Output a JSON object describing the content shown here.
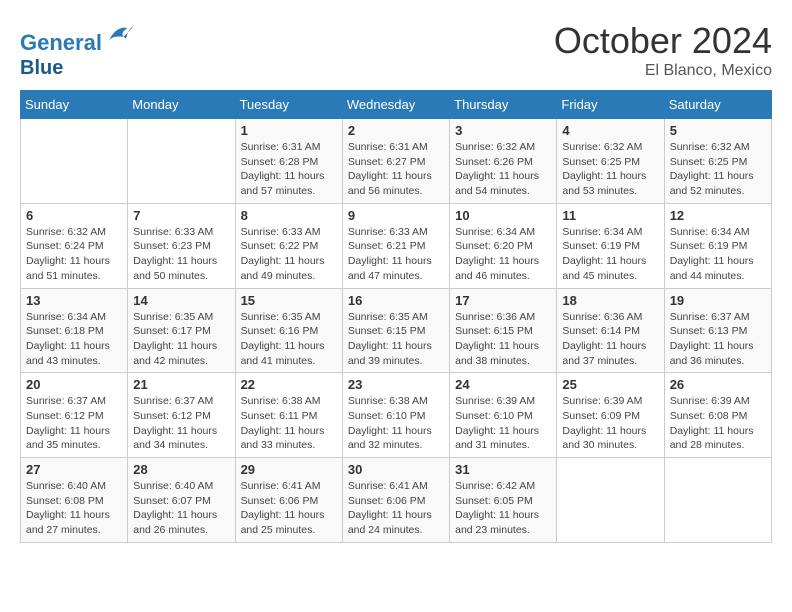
{
  "header": {
    "logo_line1": "General",
    "logo_line2": "Blue",
    "month": "October 2024",
    "location": "El Blanco, Mexico"
  },
  "weekdays": [
    "Sunday",
    "Monday",
    "Tuesday",
    "Wednesday",
    "Thursday",
    "Friday",
    "Saturday"
  ],
  "weeks": [
    [
      {
        "day": "",
        "info": ""
      },
      {
        "day": "",
        "info": ""
      },
      {
        "day": "1",
        "info": "Sunrise: 6:31 AM\nSunset: 6:28 PM\nDaylight: 11 hours and 57 minutes."
      },
      {
        "day": "2",
        "info": "Sunrise: 6:31 AM\nSunset: 6:27 PM\nDaylight: 11 hours and 56 minutes."
      },
      {
        "day": "3",
        "info": "Sunrise: 6:32 AM\nSunset: 6:26 PM\nDaylight: 11 hours and 54 minutes."
      },
      {
        "day": "4",
        "info": "Sunrise: 6:32 AM\nSunset: 6:25 PM\nDaylight: 11 hours and 53 minutes."
      },
      {
        "day": "5",
        "info": "Sunrise: 6:32 AM\nSunset: 6:25 PM\nDaylight: 11 hours and 52 minutes."
      }
    ],
    [
      {
        "day": "6",
        "info": "Sunrise: 6:32 AM\nSunset: 6:24 PM\nDaylight: 11 hours and 51 minutes."
      },
      {
        "day": "7",
        "info": "Sunrise: 6:33 AM\nSunset: 6:23 PM\nDaylight: 11 hours and 50 minutes."
      },
      {
        "day": "8",
        "info": "Sunrise: 6:33 AM\nSunset: 6:22 PM\nDaylight: 11 hours and 49 minutes."
      },
      {
        "day": "9",
        "info": "Sunrise: 6:33 AM\nSunset: 6:21 PM\nDaylight: 11 hours and 47 minutes."
      },
      {
        "day": "10",
        "info": "Sunrise: 6:34 AM\nSunset: 6:20 PM\nDaylight: 11 hours and 46 minutes."
      },
      {
        "day": "11",
        "info": "Sunrise: 6:34 AM\nSunset: 6:19 PM\nDaylight: 11 hours and 45 minutes."
      },
      {
        "day": "12",
        "info": "Sunrise: 6:34 AM\nSunset: 6:19 PM\nDaylight: 11 hours and 44 minutes."
      }
    ],
    [
      {
        "day": "13",
        "info": "Sunrise: 6:34 AM\nSunset: 6:18 PM\nDaylight: 11 hours and 43 minutes."
      },
      {
        "day": "14",
        "info": "Sunrise: 6:35 AM\nSunset: 6:17 PM\nDaylight: 11 hours and 42 minutes."
      },
      {
        "day": "15",
        "info": "Sunrise: 6:35 AM\nSunset: 6:16 PM\nDaylight: 11 hours and 41 minutes."
      },
      {
        "day": "16",
        "info": "Sunrise: 6:35 AM\nSunset: 6:15 PM\nDaylight: 11 hours and 39 minutes."
      },
      {
        "day": "17",
        "info": "Sunrise: 6:36 AM\nSunset: 6:15 PM\nDaylight: 11 hours and 38 minutes."
      },
      {
        "day": "18",
        "info": "Sunrise: 6:36 AM\nSunset: 6:14 PM\nDaylight: 11 hours and 37 minutes."
      },
      {
        "day": "19",
        "info": "Sunrise: 6:37 AM\nSunset: 6:13 PM\nDaylight: 11 hours and 36 minutes."
      }
    ],
    [
      {
        "day": "20",
        "info": "Sunrise: 6:37 AM\nSunset: 6:12 PM\nDaylight: 11 hours and 35 minutes."
      },
      {
        "day": "21",
        "info": "Sunrise: 6:37 AM\nSunset: 6:12 PM\nDaylight: 11 hours and 34 minutes."
      },
      {
        "day": "22",
        "info": "Sunrise: 6:38 AM\nSunset: 6:11 PM\nDaylight: 11 hours and 33 minutes."
      },
      {
        "day": "23",
        "info": "Sunrise: 6:38 AM\nSunset: 6:10 PM\nDaylight: 11 hours and 32 minutes."
      },
      {
        "day": "24",
        "info": "Sunrise: 6:39 AM\nSunset: 6:10 PM\nDaylight: 11 hours and 31 minutes."
      },
      {
        "day": "25",
        "info": "Sunrise: 6:39 AM\nSunset: 6:09 PM\nDaylight: 11 hours and 30 minutes."
      },
      {
        "day": "26",
        "info": "Sunrise: 6:39 AM\nSunset: 6:08 PM\nDaylight: 11 hours and 28 minutes."
      }
    ],
    [
      {
        "day": "27",
        "info": "Sunrise: 6:40 AM\nSunset: 6:08 PM\nDaylight: 11 hours and 27 minutes."
      },
      {
        "day": "28",
        "info": "Sunrise: 6:40 AM\nSunset: 6:07 PM\nDaylight: 11 hours and 26 minutes."
      },
      {
        "day": "29",
        "info": "Sunrise: 6:41 AM\nSunset: 6:06 PM\nDaylight: 11 hours and 25 minutes."
      },
      {
        "day": "30",
        "info": "Sunrise: 6:41 AM\nSunset: 6:06 PM\nDaylight: 11 hours and 24 minutes."
      },
      {
        "day": "31",
        "info": "Sunrise: 6:42 AM\nSunset: 6:05 PM\nDaylight: 11 hours and 23 minutes."
      },
      {
        "day": "",
        "info": ""
      },
      {
        "day": "",
        "info": ""
      }
    ]
  ]
}
